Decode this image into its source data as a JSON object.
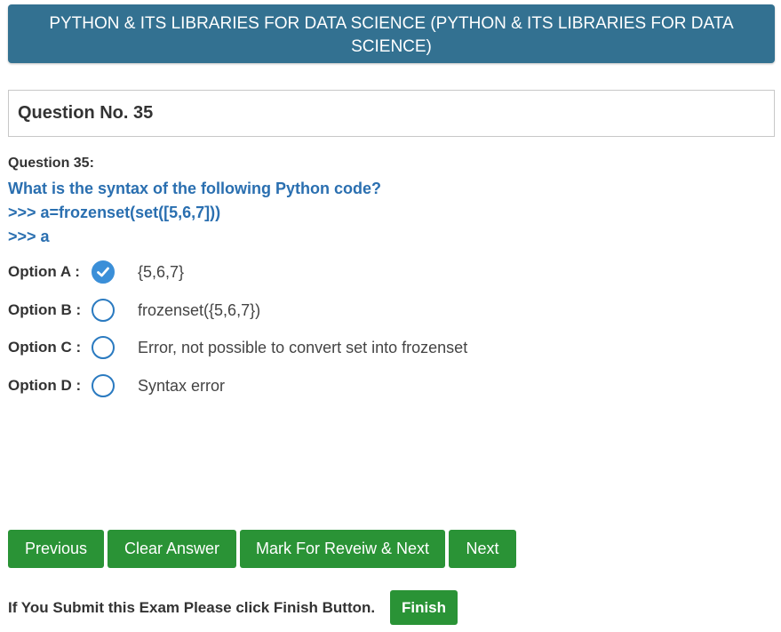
{
  "header": {
    "title": "PYTHON & ITS LIBRARIES FOR DATA SCIENCE (PYTHON & ITS LIBRARIES FOR DATA SCIENCE)"
  },
  "question_number_box": {
    "text": "Question No. 35"
  },
  "question": {
    "label": "Question 35:",
    "lines": [
      "What is the syntax of the following Python code?",
      ">>> a=frozenset(set([5,6,7]))",
      ">>> a"
    ]
  },
  "options": [
    {
      "label": "Option A :",
      "text": "{5,6,7}",
      "selected": true
    },
    {
      "label": "Option B :",
      "text": "frozenset({5,6,7})",
      "selected": false
    },
    {
      "label": "Option C :",
      "text": "Error, not possible to convert set into frozenset",
      "selected": false
    },
    {
      "label": "Option D :",
      "text": "Syntax error",
      "selected": false
    }
  ],
  "buttons": {
    "previous": "Previous",
    "clear_answer": "Clear Answer",
    "mark_review_next": "Mark For Reveiw & Next",
    "next": "Next"
  },
  "footer": {
    "instruction": "If You Submit this Exam Please click Finish Button.",
    "finish": "Finish"
  },
  "colors": {
    "header_bg": "#337191",
    "question_text": "#2a6fb0",
    "radio": "#2a7ac0",
    "radio_checked": "#3b8fd8",
    "button_green": "#2a9336"
  },
  "icons": {
    "radio_checked": "check-icon",
    "radio_unchecked": "radio-empty-icon"
  }
}
